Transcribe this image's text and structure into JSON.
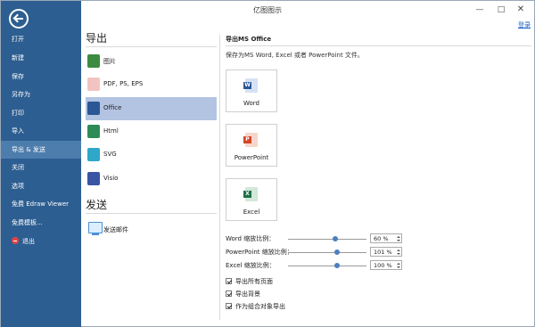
{
  "window": {
    "title": "亿图图示",
    "min_glyph": "—",
    "max_glyph": "□",
    "close_glyph": "✕",
    "login_label": "登录"
  },
  "sidebar": {
    "items": [
      {
        "label": "打开"
      },
      {
        "label": "新建"
      },
      {
        "label": "保存"
      },
      {
        "label": "另存为"
      },
      {
        "label": "打印"
      },
      {
        "label": "导入"
      },
      {
        "label": "导出 & 发送",
        "active": true
      },
      {
        "label": "关闭"
      },
      {
        "label": "选项"
      },
      {
        "label": "免费 Edraw Viewer"
      },
      {
        "label": "免费模板..."
      },
      {
        "label": "退出",
        "icon": "exit-icon"
      }
    ]
  },
  "export_section": {
    "title": "导出",
    "items": [
      {
        "label": "图片",
        "icon": "image-icon",
        "color": "#3d8b40"
      },
      {
        "label": "PDF, PS, EPS",
        "icon": "pdf-icon",
        "color": "#d9534f"
      },
      {
        "label": "Office",
        "icon": "office-icon",
        "color": "#2b5797",
        "active": true
      },
      {
        "label": "Html",
        "icon": "html-icon",
        "color": "#2e8b57"
      },
      {
        "label": "SVG",
        "icon": "svg-icon",
        "color": "#2fa7c9"
      },
      {
        "label": "Visio",
        "icon": "visio-icon",
        "color": "#3955a3"
      }
    ]
  },
  "send_section": {
    "title": "发送",
    "items": [
      {
        "label": "发送邮件",
        "icon": "send-mail-icon"
      }
    ]
  },
  "office_panel": {
    "title": "导出MS Office",
    "description": "保存为MS Word, Excel 或者 PowerPoint 文件。",
    "buttons": [
      {
        "label": "Word",
        "icon": "word-icon",
        "badge": "W",
        "color": "#2b5797"
      },
      {
        "label": "PowerPoint",
        "icon": "powerpoint-icon",
        "badge": "P",
        "color": "#d24726"
      },
      {
        "label": "Excel",
        "icon": "excel-icon",
        "badge": "X",
        "color": "#1e7145"
      }
    ],
    "scales": [
      {
        "label": "Word 缩放比例：",
        "value": "60 %",
        "fraction": 0.6
      },
      {
        "label": "PowerPoint 缩放比例：",
        "value": "101 %",
        "fraction": 0.62
      },
      {
        "label": "Excel 缩放比例：",
        "value": "100 %",
        "fraction": 0.62
      }
    ],
    "options": [
      {
        "label": "导出所有页面",
        "checked": true
      },
      {
        "label": "导出背景",
        "checked": true
      },
      {
        "label": "作为组合对象导出",
        "checked": true
      }
    ]
  },
  "colors": {
    "sidebar_bg": "#2d5e91",
    "sidebar_active": "#4d7dad",
    "selected_item": "#b3c4e2",
    "link": "#1a62c9"
  }
}
